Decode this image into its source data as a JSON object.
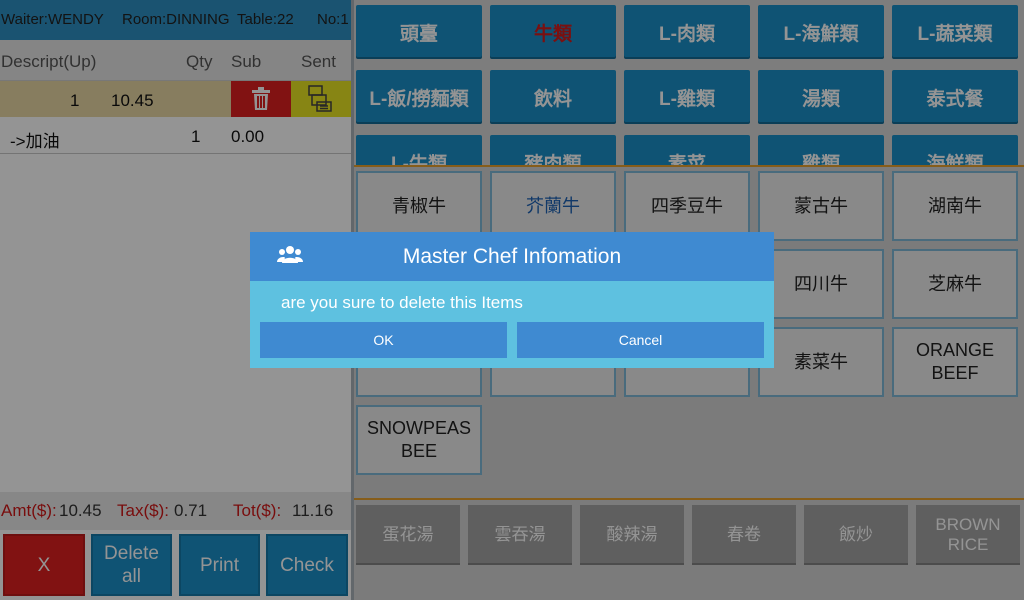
{
  "header": {
    "waiter": "Waiter:WENDY",
    "room": "Room:DINNING",
    "table": "Table:22",
    "number": "No:1"
  },
  "order_columns": {
    "descript": "Descript(Up)",
    "qty": "Qty",
    "sub": "Sub",
    "sent": "Sent"
  },
  "order_rows": [
    {
      "qty": "1",
      "sub": "10.45"
    },
    {
      "desc": "->加油",
      "qty": "1",
      "sub": "0.00"
    }
  ],
  "totals": {
    "amt_label": "Amt($):",
    "amt_value": "10.45",
    "tax_label": "Tax($):",
    "tax_value": "0.71",
    "tot_label": "Tot($):",
    "tot_value": "11.16"
  },
  "actions": {
    "x": "X",
    "delete_all_line1": "Delete",
    "delete_all_line2": "all",
    "print": "Print",
    "check": "Check"
  },
  "categories": [
    {
      "label": "頭臺"
    },
    {
      "label": "牛類",
      "active": true
    },
    {
      "label": "L-肉類"
    },
    {
      "label": "L-海鮮類"
    },
    {
      "label": "L-蔬菜類"
    },
    {
      "label": "L-飯/撈麵類"
    },
    {
      "label": "飲料"
    },
    {
      "label": "L-雞類"
    },
    {
      "label": "湯類"
    },
    {
      "label": "泰式餐"
    },
    {
      "label": "L-牛類"
    },
    {
      "label": "豬肉類"
    },
    {
      "label": "素菜"
    },
    {
      "label": "雞類"
    },
    {
      "label": "海鮮類"
    }
  ],
  "items": [
    {
      "label": "青椒牛"
    },
    {
      "label": "芥蘭牛",
      "selected": true
    },
    {
      "label": "四季豆牛"
    },
    {
      "label": "蒙古牛"
    },
    {
      "label": "湖南牛"
    },
    {
      "label": "四川牛"
    },
    {
      "label": "芝麻牛"
    },
    {
      "label": "素菜牛"
    },
    {
      "label_line1": "ORANGE",
      "label_line2": "BEEF"
    },
    {
      "label_line1": "SNOWPEAS",
      "label_line2": "BEE"
    }
  ],
  "quick_items": [
    {
      "label": "蛋花湯"
    },
    {
      "label": "雲吞湯"
    },
    {
      "label": "酸辣湯"
    },
    {
      "label": "春卷"
    },
    {
      "label": "飯炒"
    },
    {
      "label_line1": "BROWN",
      "label_line2": "RICE"
    }
  ],
  "dialog": {
    "title": "Master Chef Infomation",
    "message": "are you sure to delete this Items",
    "ok": "OK",
    "cancel": "Cancel",
    "icon": "users-icon"
  },
  "colors": {
    "header_blue": "#2d8fc3",
    "category_blue": "#1b8fc8",
    "active_red": "#d21c1c",
    "delete_red": "#de1f1f",
    "sent_yellow": "#e8e624",
    "dialog_blue": "#3f8ad1",
    "dialog_body": "#5ec1e0",
    "divider_orange": "#e7a12d"
  }
}
